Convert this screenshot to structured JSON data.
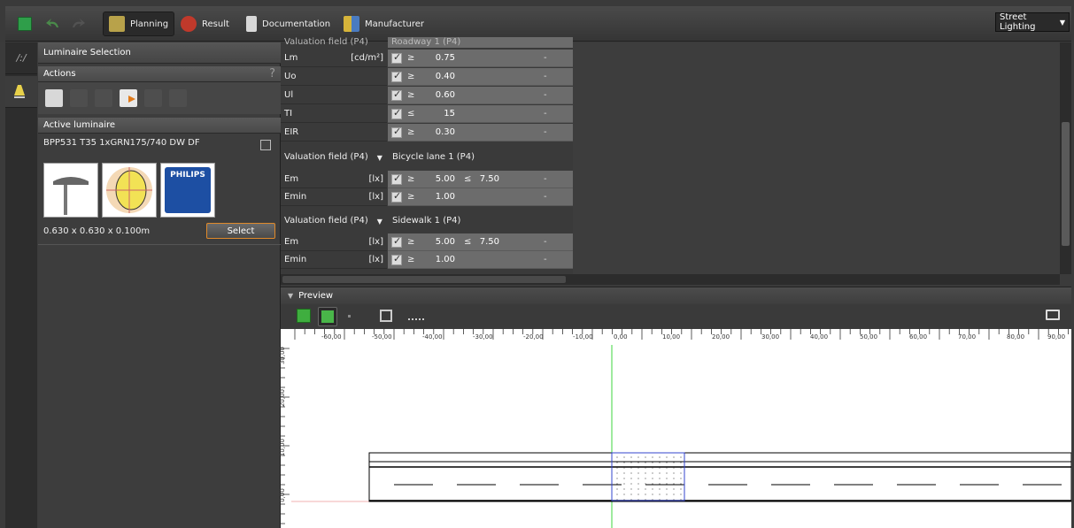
{
  "toolbar": {
    "tabs": [
      {
        "label": "Planning",
        "active": true
      },
      {
        "label": "Result"
      },
      {
        "label": "Documentation"
      },
      {
        "label": "Manufacturer"
      }
    ],
    "mode": "Street Lighting"
  },
  "panel": {
    "title": "Luminaire Selection",
    "actions_label": "Actions",
    "help": "?",
    "active_label": "Active luminaire",
    "luminaire_name": "BPP531 T35 1xGRN175/740 DW DF",
    "brand": "PHILIPS",
    "dimensions": "0.630 x 0.630 x 0.100m",
    "select_label": "Select"
  },
  "grid": {
    "top_partial_label": "Valuation field (P4)",
    "top_partial_value": "Roadway 1 (P4)",
    "roadway_rows": [
      {
        "name": "Lm",
        "unit": "[cd/m²]",
        "sym": "≥",
        "value": "0.75",
        "dash": "-"
      },
      {
        "name": "Uo",
        "unit": "",
        "sym": "≥",
        "value": "0.40",
        "dash": "-"
      },
      {
        "name": "Ul",
        "unit": "",
        "sym": "≥",
        "value": "0.60",
        "dash": "-"
      },
      {
        "name": "TI",
        "unit": "",
        "sym": "≤",
        "value": "15",
        "dash": "-"
      },
      {
        "name": "EIR",
        "unit": "",
        "sym": "≥",
        "value": "0.30",
        "dash": "-"
      }
    ],
    "groups": [
      {
        "label": "Valuation field (P4)",
        "value": "Bicycle lane 1 (P4)",
        "rows": [
          {
            "name": "Em",
            "unit": "[lx]",
            "sym": "≥",
            "value": "5.00",
            "sym2": "≤",
            "value2": "7.50",
            "dash": "-"
          },
          {
            "name": "Emin",
            "unit": "[lx]",
            "sym": "≥",
            "value": "1.00",
            "dash": "-"
          }
        ]
      },
      {
        "label": "Valuation field (P4)",
        "value": "Sidewalk 1 (P4)",
        "rows": [
          {
            "name": "Em",
            "unit": "[lx]",
            "sym": "≥",
            "value": "5.00",
            "sym2": "≤",
            "value2": "7.50",
            "dash": "-"
          },
          {
            "name": "Emin",
            "unit": "[lx]",
            "sym": "≥",
            "value": "1.00",
            "dash": "-"
          }
        ]
      }
    ]
  },
  "preview": {
    "title": "Preview",
    "ruler_x": [
      "-60,00",
      "-50,00",
      "-40,00",
      "-30,00",
      "-20,00",
      "-10,00",
      "0,00",
      "10,00",
      "20,00",
      "30,00",
      "40,00",
      "50,00",
      "60,00",
      "70,00",
      "80,00",
      "90,00"
    ],
    "ruler_y": [
      "30,00",
      "20,00",
      "10,00",
      "0,00"
    ]
  }
}
